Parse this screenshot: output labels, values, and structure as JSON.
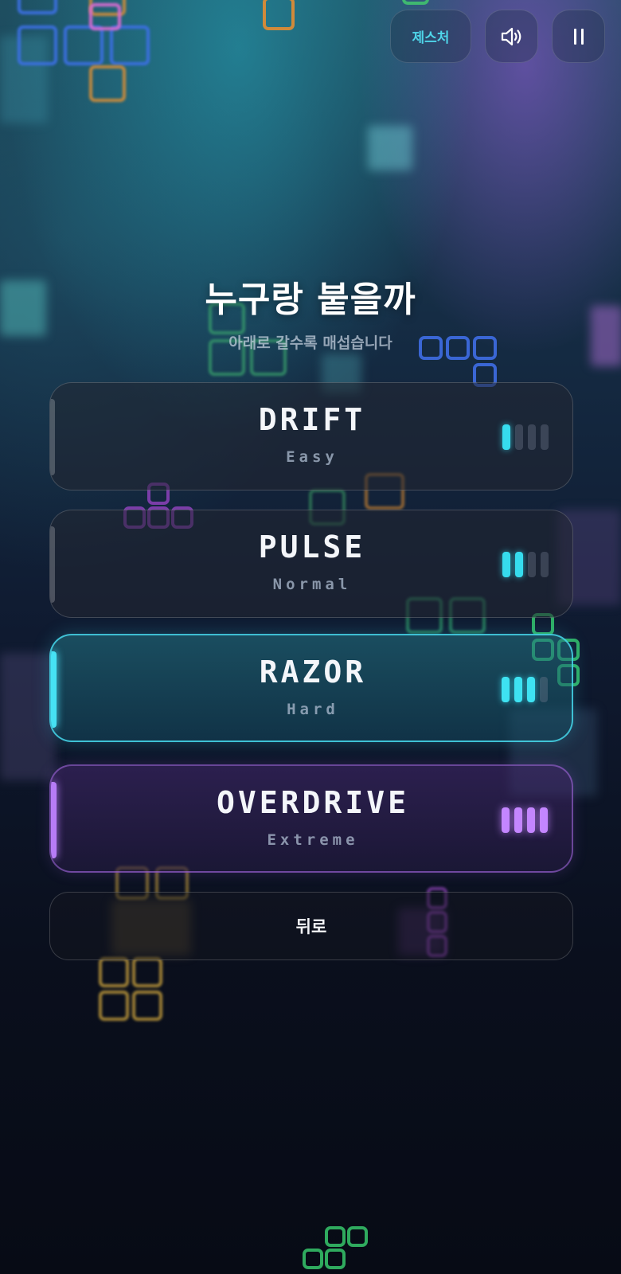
{
  "top_bar": {
    "gesture_label": "제스처",
    "sound_icon": "speaker-volume-icon",
    "pause_icon": "pause-icon"
  },
  "header": {
    "title": "누구랑 붙을까",
    "subtitle": "아래로 갈수록 매섭습니다"
  },
  "difficulties": [
    {
      "name": "DRIFT",
      "level": "Easy",
      "bars_filled": 1,
      "bars_total": 4,
      "selected": false
    },
    {
      "name": "PULSE",
      "level": "Normal",
      "bars_filled": 2,
      "bars_total": 4,
      "selected": false
    },
    {
      "name": "RAZOR",
      "level": "Hard",
      "bars_filled": 3,
      "bars_total": 4,
      "selected": true
    },
    {
      "name": "OVERDRIVE",
      "level": "Extreme",
      "bars_filled": 4,
      "bars_total": 4,
      "selected": false
    }
  ],
  "back_label": "뒤로",
  "colors": {
    "accent_cyan": "#36dcee",
    "accent_purple": "#c486ff",
    "background_dark": "#0a0f1d"
  }
}
